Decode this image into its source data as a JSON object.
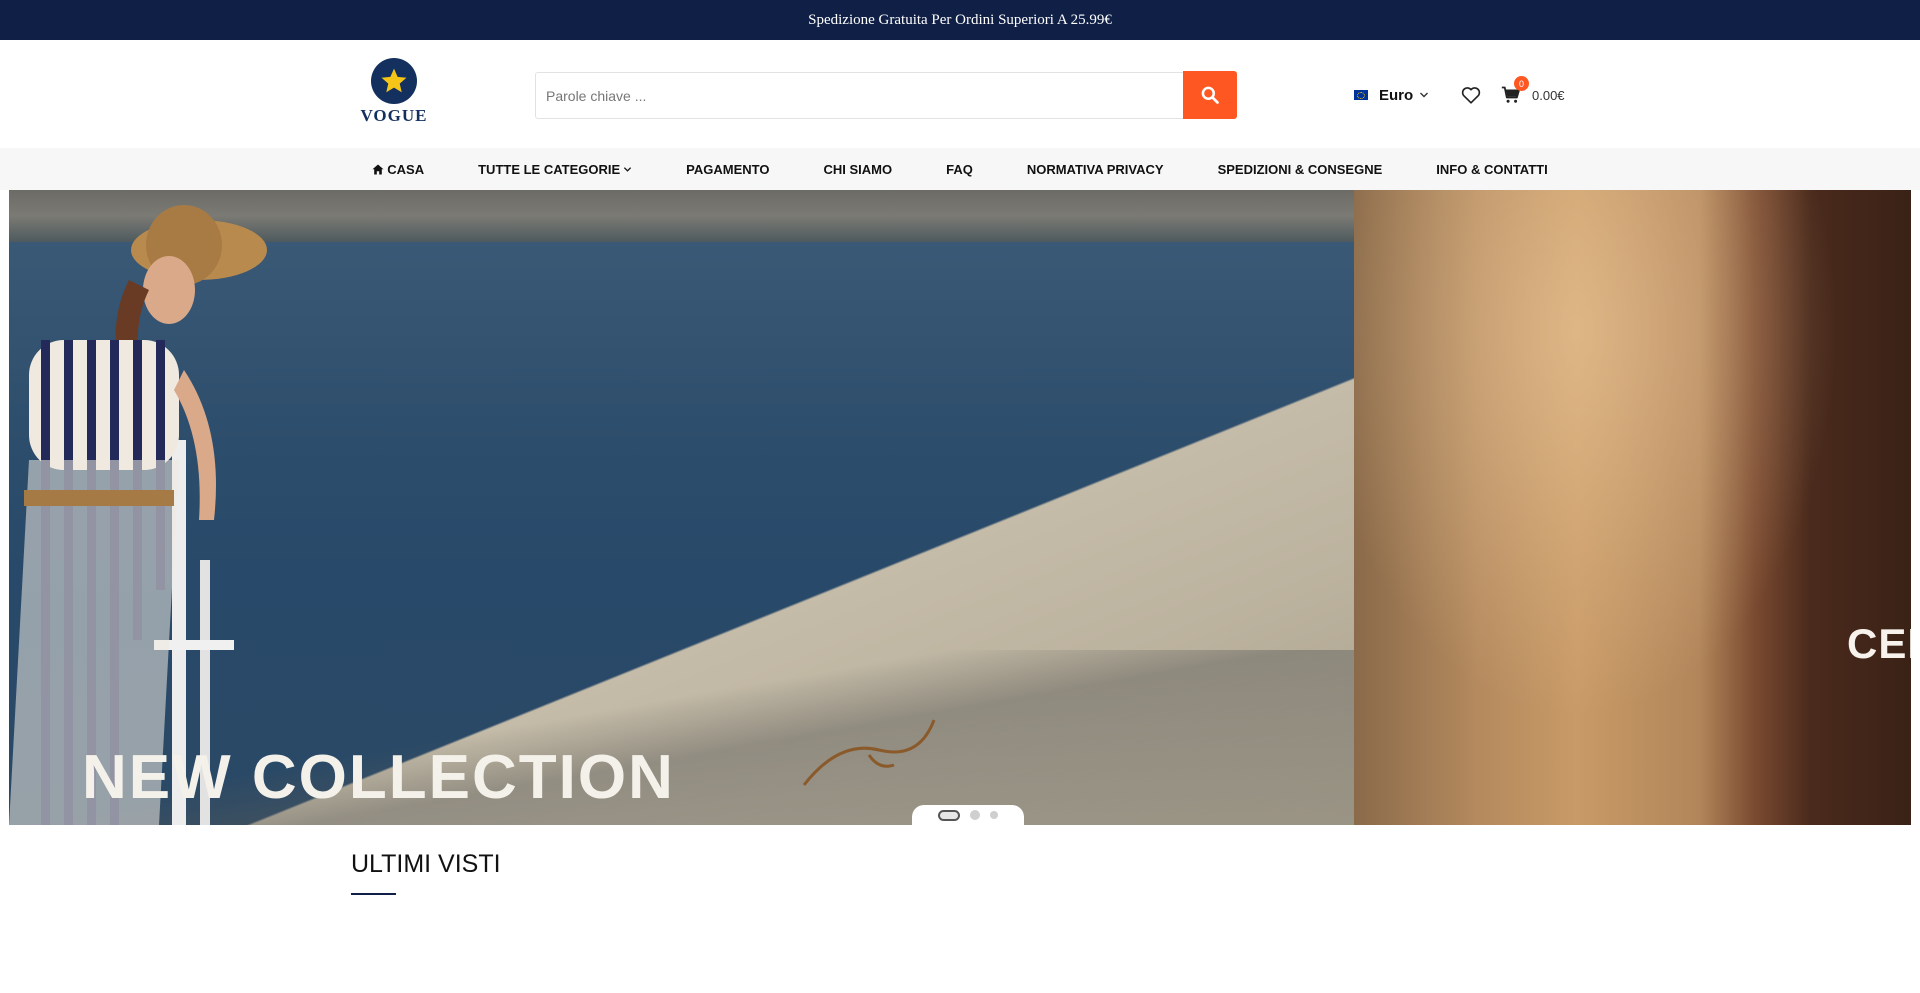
{
  "announcement": "Spedizione Gratuita Per Ordini Superiori A 25.99€",
  "logo": {
    "text": "VOGUE"
  },
  "search": {
    "placeholder": "Parole chiave ..."
  },
  "currency": {
    "label": "Euro"
  },
  "cart": {
    "count": "0",
    "total": "0.00€"
  },
  "nav": {
    "items": [
      {
        "label": "CASA",
        "icon": "home-icon"
      },
      {
        "label": "TUTTE LE CATEGORIE",
        "icon": "chevron-down-icon"
      },
      {
        "label": "PAGAMENTO"
      },
      {
        "label": "CHI SIAMO"
      },
      {
        "label": "FAQ"
      },
      {
        "label": "NORMATIVA PRIVACY"
      },
      {
        "label": "SPEDIZIONI & CONSEGNE"
      },
      {
        "label": "INFO & CONTATTI"
      }
    ]
  },
  "hero": {
    "caption": "NEW COLLECTION",
    "next_caption": "CER",
    "slide_count": 3,
    "active_slide": 1
  },
  "sections": {
    "recently_viewed_title": "ULTIMI VISTI"
  },
  "colors": {
    "topbar": "#0f1f45",
    "accent": "#ff5722"
  }
}
